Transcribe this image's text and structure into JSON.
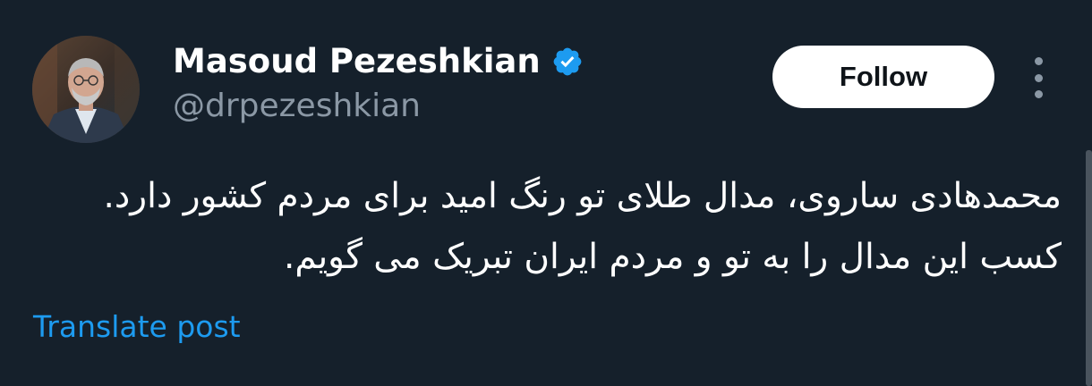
{
  "author": {
    "display_name": "Masoud Pezeshkian",
    "handle": "@drpezeshkian",
    "verified": true,
    "verified_color": "#1d9bf0"
  },
  "actions": {
    "follow_label": "Follow",
    "more_icon": "more-vertical-icon"
  },
  "post": {
    "lines": [
      "محمدهادی ساروی، مدال طلای تو رنگ امید برای مردم کشور دارد.",
      "کسب این مدال را به تو و مردم ایران تبریک می گویم."
    ]
  },
  "translate_label": "Translate post",
  "colors": {
    "background": "#15202b",
    "text": "#ffffff",
    "secondary_text": "#8b98a5",
    "link": "#1d9bf0"
  }
}
